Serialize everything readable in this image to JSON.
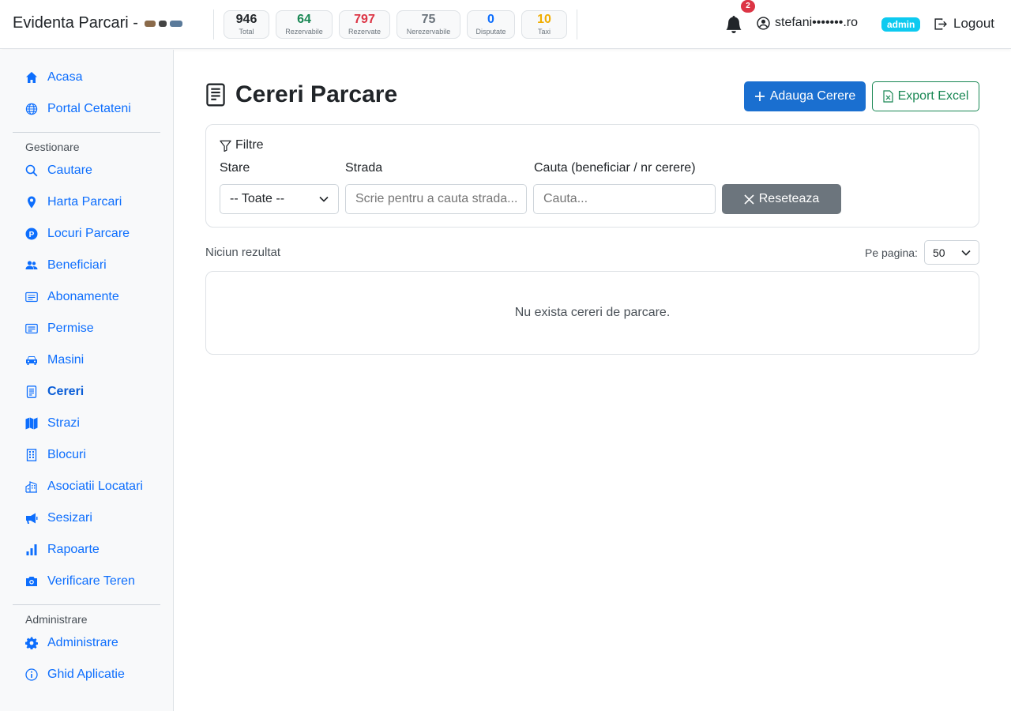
{
  "header": {
    "brand": "Evidenta Parcari -",
    "stats": [
      {
        "value": "946",
        "label": "Total",
        "color": "#212529"
      },
      {
        "value": "64",
        "label": "Rezervabile",
        "color": "#198754"
      },
      {
        "value": "797",
        "label": "Rezervate",
        "color": "#dc3545"
      },
      {
        "value": "75",
        "label": "Nerezervabile",
        "color": "#6c757d"
      },
      {
        "value": "0",
        "label": "Disputate",
        "color": "#0d6efd"
      },
      {
        "value": "10",
        "label": "Taxi",
        "color": "#f0ad00"
      }
    ],
    "notifications_count": "2",
    "user_email": "stefani•••••••.ro",
    "role_badge": "admin",
    "logout_label": "Logout"
  },
  "sidebar": {
    "top_items": [
      {
        "label": "Acasa",
        "icon": "house-icon"
      },
      {
        "label": "Portal Cetateni",
        "icon": "globe-icon"
      }
    ],
    "section_gestionare": "Gestionare",
    "gestionare_items": [
      {
        "label": "Cautare",
        "icon": "search-icon"
      },
      {
        "label": "Harta Parcari",
        "icon": "map-pin-icon"
      },
      {
        "label": "Locuri Parcare",
        "icon": "parking-icon"
      },
      {
        "label": "Beneficiari",
        "icon": "people-icon"
      },
      {
        "label": "Abonamente",
        "icon": "card-list-icon"
      },
      {
        "label": "Permise",
        "icon": "card-text-icon"
      },
      {
        "label": "Masini",
        "icon": "car-icon"
      },
      {
        "label": "Cereri",
        "icon": "document-icon",
        "active": true
      },
      {
        "label": "Strazi",
        "icon": "map-icon"
      },
      {
        "label": "Blocuri",
        "icon": "building-icon"
      },
      {
        "label": "Asociatii Locatari",
        "icon": "buildings-icon"
      },
      {
        "label": "Sesizari",
        "icon": "megaphone-icon"
      },
      {
        "label": "Rapoarte",
        "icon": "bar-chart-icon"
      },
      {
        "label": "Verificare Teren",
        "icon": "camera-icon"
      }
    ],
    "section_administrare": "Administrare",
    "administrare_items": [
      {
        "label": "Administrare",
        "icon": "gear-icon"
      },
      {
        "label": "Ghid Aplicatie",
        "icon": "info-icon"
      }
    ]
  },
  "main": {
    "title": "Cereri Parcare",
    "add_button": "Adauga Cerere",
    "export_button": "Export Excel",
    "filters": {
      "title": "Filtre",
      "status_label": "Stare",
      "status_value": "-- Toate --",
      "street_label": "Strada",
      "street_placeholder": "Scrie pentru a cauta strada...",
      "search_label": "Cauta (beneficiar / nr cerere)",
      "search_placeholder": "Cauta...",
      "reset_button": "Reseteaza"
    },
    "results_text": "Niciun rezultat",
    "per_page_label": "Pe pagina:",
    "per_page_value": "50",
    "empty_message": "Nu exista cereri de parcare."
  },
  "colors": {
    "primary": "#1a6fd0",
    "link": "#0d6efd",
    "success": "#198754",
    "secondary": "#6c757d",
    "danger": "#dc3545",
    "info": "#0dcaf0"
  }
}
